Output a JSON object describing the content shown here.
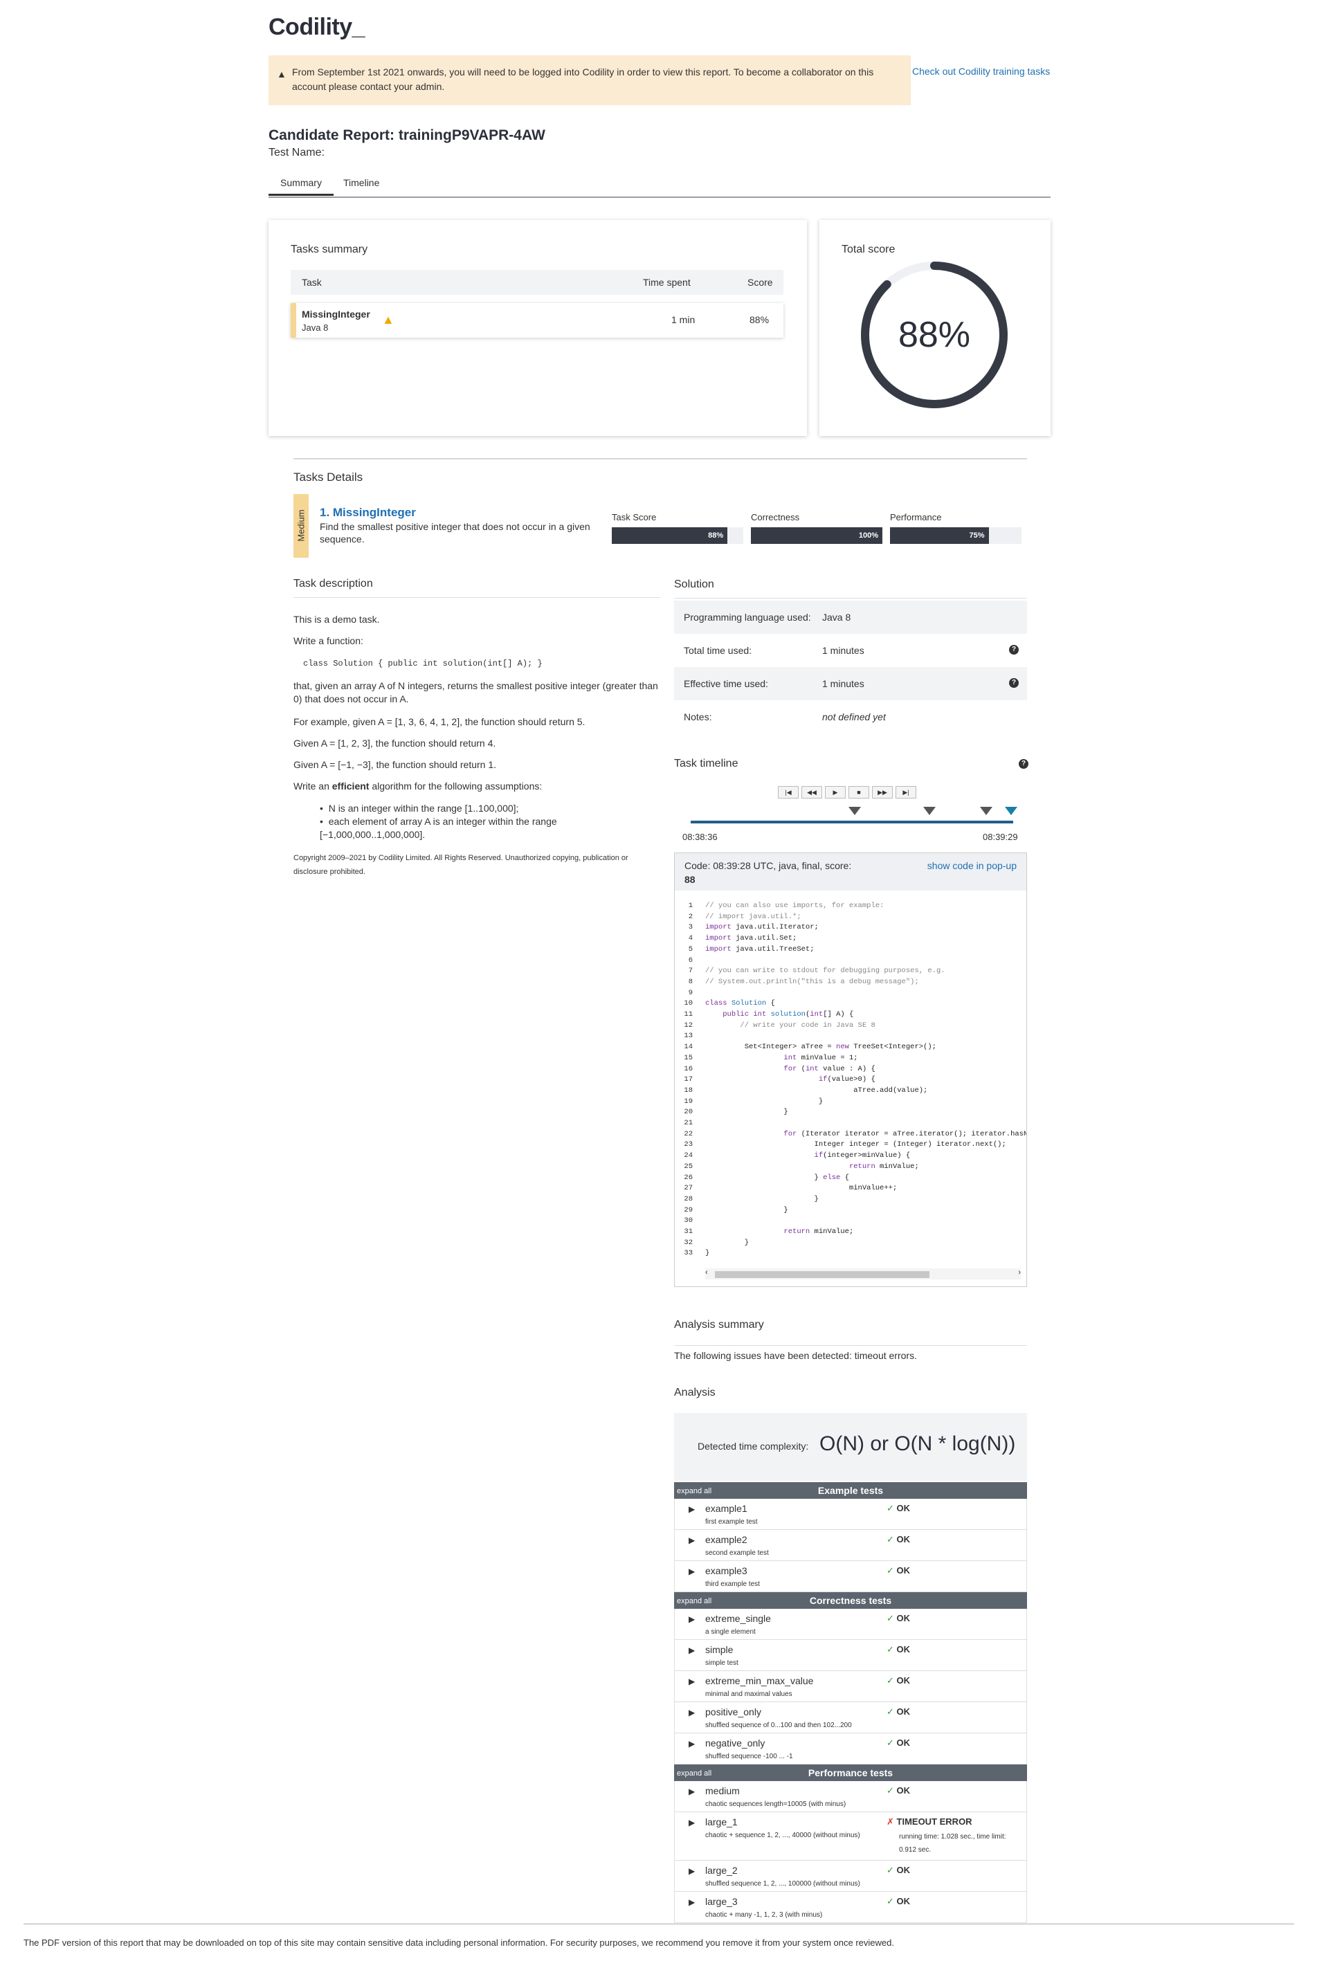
{
  "logo": "Codility_",
  "notice": {
    "icon": "warning-icon",
    "text": "From September 1st 2021 onwards, you will need to be logged into Codility in order to view this report. To become a collaborator on this account please contact your admin.",
    "link": "Check out Codility training tasks"
  },
  "report": {
    "title": "Candidate Report: trainingP9VAPR-4AW",
    "test_name": "Test Name:"
  },
  "tabs": [
    "Summary",
    "Timeline"
  ],
  "tasks_summary": {
    "title": "Tasks summary",
    "headers": [
      "Task",
      "Time spent",
      "Score"
    ],
    "row": {
      "name": "MissingInteger",
      "lang": "Java 8",
      "time": "1 min",
      "score": "88%"
    }
  },
  "total_score": {
    "title": "Total score",
    "value": "88%",
    "fraction": 0.88
  },
  "tasks_details": {
    "title": "Tasks Details",
    "difficulty": "Medium",
    "name": "1. MissingInteger",
    "desc": "Find the smallest positive integer that does not occur in a given sequence.",
    "bars": [
      {
        "label": "Task Score",
        "text": "88%",
        "value": 0.88
      },
      {
        "label": "Correctness",
        "text": "100%",
        "value": 1.0
      },
      {
        "label": "Performance",
        "text": "75%",
        "value": 0.75
      }
    ]
  },
  "description": {
    "title": "Task description",
    "p1": "This is a demo task.",
    "p2": "Write a function:",
    "code": "class Solution { public int solution(int[] A); }",
    "p3": "that, given an array A of N integers, returns the smallest positive integer (greater than 0) that does not occur in A.",
    "p4": "For example, given A = [1, 3, 6, 4, 1, 2], the function should return 5.",
    "p5": "Given A = [1, 2, 3], the function should return 4.",
    "p6": "Given A = [−1, −3], the function should return 1.",
    "p7a": "Write an ",
    "p7b": "efficient",
    "p7c": " algorithm for the following assumptions:",
    "b1": "N is an integer within the range [1..100,000];",
    "b2": "each element of array A is an integer within the range [−1,000,000..1,000,000].",
    "copyright": "Copyright 2009–2021 by Codility Limited. All Rights Reserved. Unauthorized copying, publication or disclosure prohibited."
  },
  "solution": {
    "title": "Solution",
    "rows": [
      {
        "k": "Programming language used:",
        "v": "Java 8"
      },
      {
        "k": "Total time used:",
        "v": "1 minutes"
      },
      {
        "k": "Effective time used:",
        "v": "1 minutes"
      },
      {
        "k": "Notes:",
        "v": "not defined yet"
      }
    ]
  },
  "timeline": {
    "title": "Task timeline",
    "buttons": [
      "|◀",
      "◀◀",
      "▶",
      "■",
      "▶▶",
      "▶|"
    ],
    "start": "08:38:36",
    "end": "08:39:29"
  },
  "code": {
    "header": "Code: 08:39:28 UTC, java, final, score:",
    "score": "88",
    "popup": "show code in pop-up",
    "lines": [
      "// you can also use imports, for example:",
      "// import java.util.*;",
      "import java.util.Iterator;",
      "import java.util.Set;",
      "import java.util.TreeSet;",
      "",
      "// you can write to stdout for debugging purposes, e.g.",
      "// System.out.println(\"this is a debug message\");",
      "",
      "class Solution {",
      "    public int solution(int[] A) {",
      "        // write your code in Java SE 8",
      "",
      "         Set<Integer> aTree = new TreeSet<Integer>();",
      "                  int minValue = 1;",
      "                  for (int value : A) {",
      "                          if(value>0) {",
      "                                  aTree.add(value);",
      "                          }",
      "                  }",
      "",
      "                  for (Iterator iterator = aTree.iterator(); iterator.hasNext();) {",
      "                         Integer integer = (Integer) iterator.next();",
      "                         if(integer>minValue) {",
      "                                 return minValue;",
      "                         } else {",
      "                                 minValue++;",
      "                         }",
      "                  }",
      "",
      "                  return minValue;",
      "         }",
      "}"
    ]
  },
  "analysis_summary": {
    "title": "Analysis summary",
    "text": "The following issues have been detected: timeout errors."
  },
  "analysis": {
    "title": "Analysis",
    "complexity_label": "Detected time complexity:",
    "complexity_value": "O(N) or O(N * log(N))",
    "expand_all": "expand all",
    "groups": [
      {
        "title": "Example tests",
        "tests": [
          {
            "name": "example1",
            "desc": "first example test",
            "result": "OK"
          },
          {
            "name": "example2",
            "desc": "second example test",
            "result": "OK"
          },
          {
            "name": "example3",
            "desc": "third example test",
            "result": "OK"
          }
        ]
      },
      {
        "title": "Correctness tests",
        "tests": [
          {
            "name": "extreme_single",
            "desc": "a single element",
            "result": "OK"
          },
          {
            "name": "simple",
            "desc": "simple test",
            "result": "OK"
          },
          {
            "name": "extreme_min_max_value",
            "desc": "minimal and maximal values",
            "result": "OK"
          },
          {
            "name": "positive_only",
            "desc": "shuffled sequence of 0...100 and then 102...200",
            "result": "OK"
          },
          {
            "name": "negative_only",
            "desc": "shuffled sequence -100 ... -1",
            "result": "OK"
          }
        ]
      },
      {
        "title": "Performance tests",
        "tests": [
          {
            "name": "medium",
            "desc": "chaotic sequences length=10005 (with minus)",
            "result": "OK"
          },
          {
            "name": "large_1",
            "desc": "chaotic + sequence 1, 2, ..., 40000 (without minus)",
            "result": "TIMEOUT ERROR",
            "extra": "running time: 1.028 sec., time limit: 0.912 sec."
          },
          {
            "name": "large_2",
            "desc": "shuffled sequence 1, 2, ..., 100000 (without minus)",
            "result": "OK"
          },
          {
            "name": "large_3",
            "desc": "chaotic + many -1, 1, 2, 3 (with minus)",
            "result": "OK"
          }
        ]
      }
    ]
  },
  "footer": "The PDF version of this report that may be downloaded on top of this site may contain sensitive data including personal information. For security purposes, we recommend you remove it from your system once reviewed."
}
